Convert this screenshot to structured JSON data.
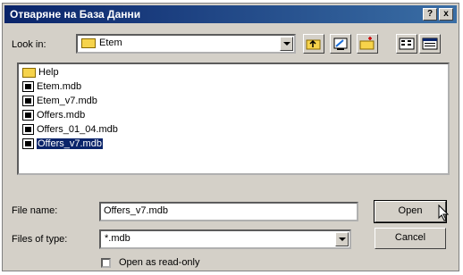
{
  "window": {
    "title": "Отваряне на База Данни"
  },
  "titlebar_buttons": {
    "help": "?",
    "close": "x"
  },
  "look_in": {
    "label": "Look in:",
    "value": "Etem"
  },
  "toolbar": {
    "icons": [
      "up-one-level-icon",
      "desktop-icon",
      "new-folder-icon",
      "list-view-icon",
      "details-view-icon"
    ]
  },
  "files": {
    "items": [
      {
        "name": "Help",
        "type": "folder"
      },
      {
        "name": "Etem.mdb",
        "type": "mdb"
      },
      {
        "name": "Etem_v7.mdb",
        "type": "mdb"
      },
      {
        "name": "Offers.mdb",
        "type": "mdb"
      },
      {
        "name": "Offers_01_04.mdb",
        "type": "mdb"
      },
      {
        "name": "Offers_v7.mdb",
        "type": "mdb",
        "selected": true
      }
    ]
  },
  "file_name": {
    "label": "File name:",
    "value": "Offers_v7.mdb"
  },
  "files_of_type": {
    "label": "Files of type:",
    "value": "*.mdb"
  },
  "buttons": {
    "open": "Open",
    "cancel": "Cancel"
  },
  "read_only": {
    "label": "Open as read-only",
    "checked": false
  },
  "colors": {
    "titlebar": "#0a246a",
    "selection": "#0a246a",
    "face": "#d4d0c8"
  }
}
